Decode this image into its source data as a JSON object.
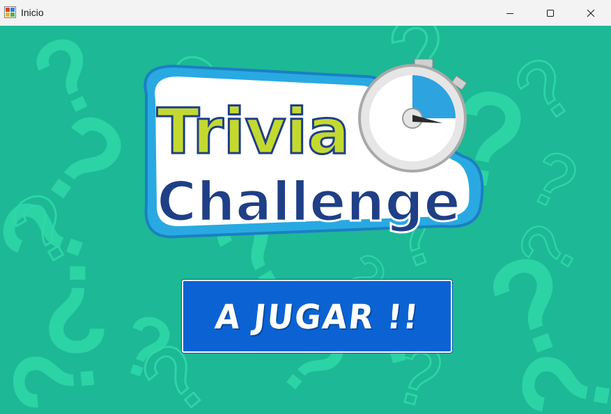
{
  "window": {
    "title": "Inicio",
    "controls": [
      "minimize",
      "maximize",
      "close"
    ]
  },
  "logo": {
    "line1": "Trivia",
    "line2": "Challenge",
    "icon": "stopwatch-icon"
  },
  "play_button": {
    "label": "A JUGAR !!"
  },
  "colors": {
    "background": "#1db895",
    "question_marks": "#2fd9a8",
    "button": "#0b63d3",
    "logo_text_top": "#c4d930",
    "logo_text_bottom": "#1f3f86",
    "logo_border": "#29a9e1"
  }
}
